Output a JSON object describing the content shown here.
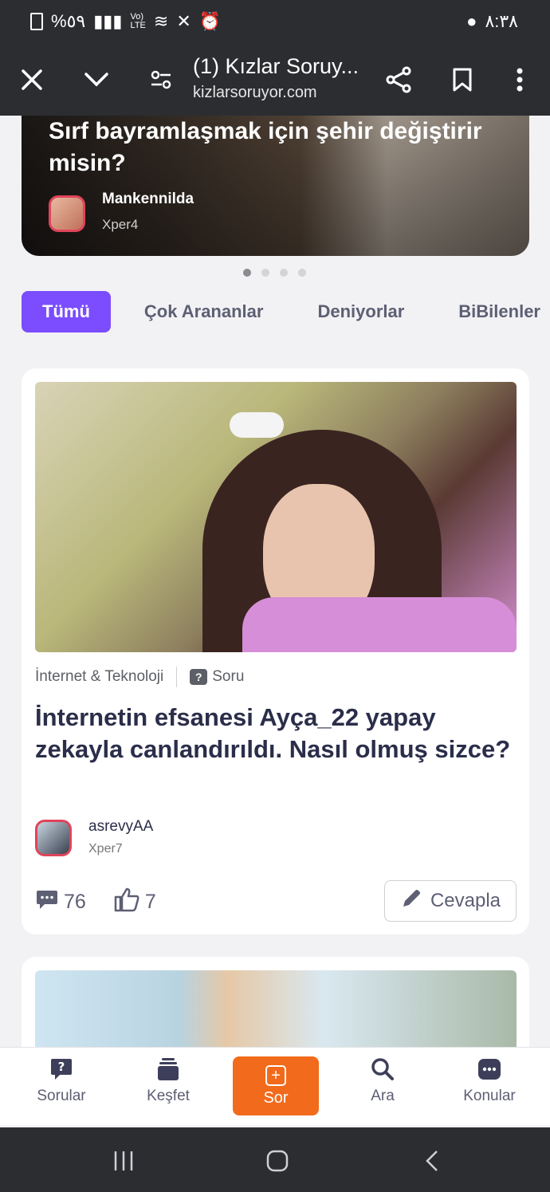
{
  "status": {
    "battery": "%٥٩",
    "time": "٨:٣٨"
  },
  "toolbar": {
    "title": "(1) Kızlar Soruy...",
    "url": "kizlarsoruyor.com"
  },
  "hero": {
    "title": "Sırf bayramlaşmak için şehir değiştirir misin?",
    "user": "Mankennilda",
    "level": "Xper4"
  },
  "tabs": [
    "Tümü",
    "Çok Arananlar",
    "Deniyorlar",
    "BiBilenler"
  ],
  "card": {
    "category": "İnternet & Teknoloji",
    "type": "Soru",
    "title": "İnternetin efsanesi Ayça_22 yapay zekayla canlandırıldı. Nasıl olmuş sizce?",
    "author": "asrevyAA",
    "level": "Xper7",
    "comments": "76",
    "likes": "7",
    "reply_label": "Cevapla"
  },
  "nav": {
    "sorular": "Sorular",
    "kesfet": "Keşfet",
    "sor": "Sor",
    "ara": "Ara",
    "konular": "Konular"
  },
  "colors": {
    "accent": "#7b4dff",
    "sor_button": "#f26a1b",
    "dark_bar": "#2b2d31"
  }
}
